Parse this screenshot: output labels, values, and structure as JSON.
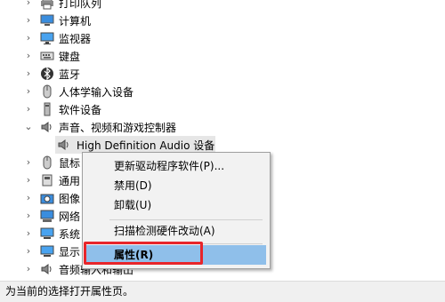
{
  "tree": {
    "items": [
      {
        "label": "打印队列",
        "icon": "printer-icon"
      },
      {
        "label": "计算机",
        "icon": "computer-icon"
      },
      {
        "label": "监视器",
        "icon": "monitor-icon"
      },
      {
        "label": "键盘",
        "icon": "keyboard-icon"
      },
      {
        "label": "蓝牙",
        "icon": "bluetooth-icon"
      },
      {
        "label": "人体学输入设备",
        "icon": "hid-icon"
      },
      {
        "label": "软件设备",
        "icon": "software-device-icon"
      },
      {
        "label": "声音、视频和游戏控制器",
        "icon": "speaker-icon"
      },
      {
        "label": "High Definition Audio 设备",
        "icon": "speaker-icon"
      },
      {
        "label": "鼠标",
        "icon": "mouse-icon"
      },
      {
        "label": "通用",
        "icon": "usb-icon"
      },
      {
        "label": "图像",
        "icon": "camera-icon"
      },
      {
        "label": "网络",
        "icon": "network-icon"
      },
      {
        "label": "系统",
        "icon": "system-icon"
      },
      {
        "label": "显示",
        "icon": "display-adapter-icon"
      },
      {
        "label": "音频输入和输出",
        "icon": "audio-io-icon"
      }
    ]
  },
  "context_menu": {
    "update_driver": "更新驱动程序软件(P)...",
    "disable": "禁用(D)",
    "uninstall": "卸载(U)",
    "scan": "扫描检测硬件改动(A)",
    "properties": "属性(R)"
  },
  "status_bar": {
    "text": "为当前的选择打开属性页。"
  },
  "colors": {
    "highlight": "#8fbfea",
    "annotation_red": "#e8252a"
  }
}
